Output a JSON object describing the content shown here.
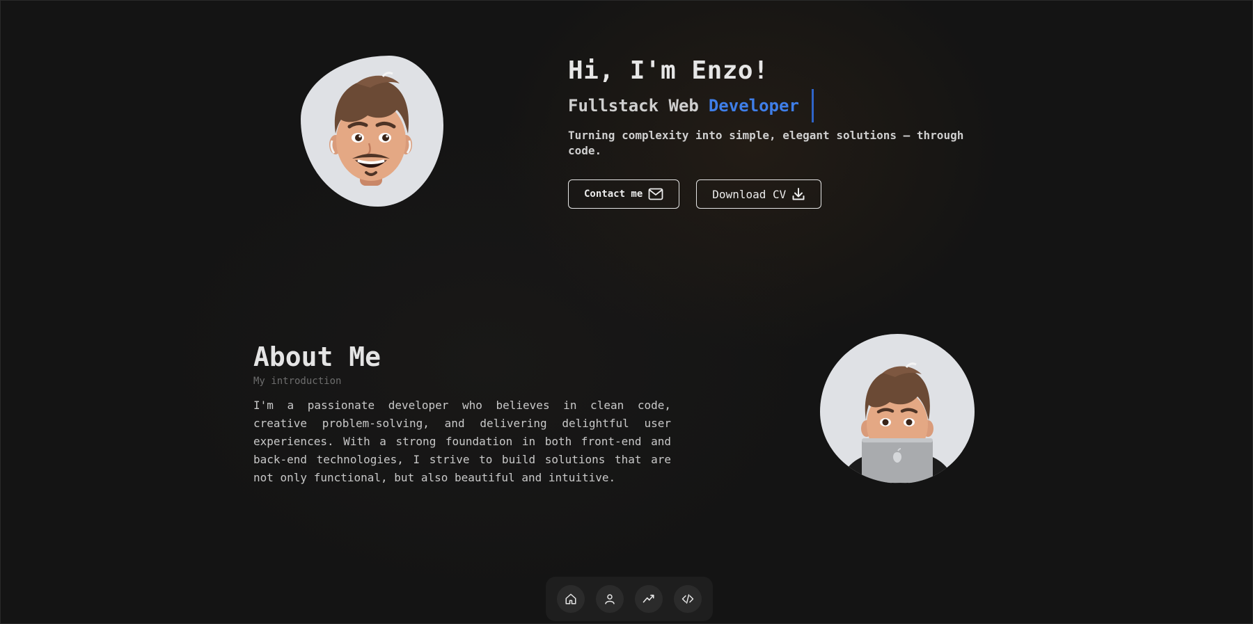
{
  "hero": {
    "greeting": "Hi, I'm Enzo!",
    "role_prefix": "Fullstack Web",
    "role_highlight": "Developer",
    "tagline": "Turning complexity into simple, elegant solutions — through code.",
    "contact_label": "Contact me",
    "contact_icon": "mail-icon",
    "cv_label": "Download CV",
    "cv_icon": "download-icon",
    "avatar_icon": "memoji-avatar"
  },
  "about": {
    "title": "About Me",
    "subtitle": "My introduction",
    "body": "I'm a passionate developer who believes in clean code, creative problem-solving, and delivering delightful user experiences. With a strong foundation in both front-end and back-end technologies, I strive to build solutions that are not only functional, but also beautiful and intuitive.",
    "avatar_icon": "memoji-laptop-avatar"
  },
  "nav": {
    "items": [
      {
        "icon": "home-icon"
      },
      {
        "icon": "user-icon"
      },
      {
        "icon": "trending-icon"
      },
      {
        "icon": "code-icon"
      }
    ]
  },
  "colors": {
    "background": "#141414",
    "accent": "#3f7ee8",
    "text": "#e6e6e6",
    "muted": "#6d6d6d"
  }
}
